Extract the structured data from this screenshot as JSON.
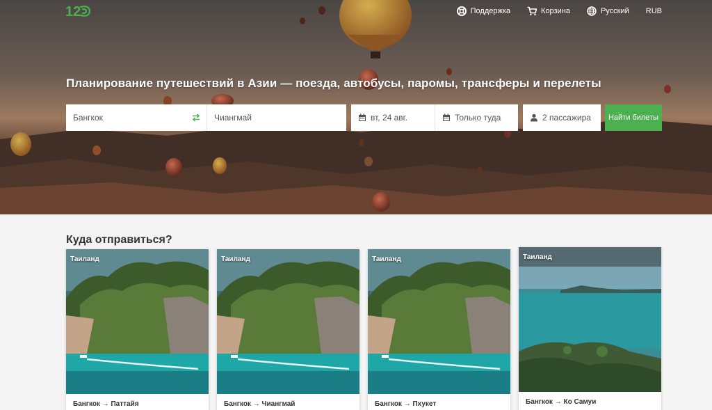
{
  "header": {
    "logo_text": "12go",
    "nav": [
      {
        "label": "Поддержка",
        "icon": "lifebuoy-icon"
      },
      {
        "label": "Корзина",
        "icon": "cart-icon"
      },
      {
        "label": "Русский",
        "icon": "globe-icon"
      },
      {
        "label": "RUB",
        "icon": ""
      }
    ]
  },
  "hero": {
    "headline": "Планирование путешествий в Азии — поезда, автобусы, паромы, трансферы и перелеты"
  },
  "search": {
    "from": "Бангкок",
    "to": "Чиангмай",
    "date": "вт, 24 авг.",
    "trip_type": "Только туда",
    "passengers": "2 пассажира",
    "submit_label": "Найти билеты"
  },
  "destinations": {
    "title": "Куда отправиться?",
    "cards": [
      {
        "tag": "Таиланд",
        "route": "Бангкок → Паттайя"
      },
      {
        "tag": "Таиланд",
        "route": "Бангкок → Чиангмай"
      },
      {
        "tag": "Таиланд",
        "route": "Бангкок → Пхукет"
      },
      {
        "tag": "Таиланд",
        "route": "Бангкок → Ко Самуи"
      }
    ]
  },
  "colors": {
    "accent": "#4caf50",
    "logo": "#4caf50"
  }
}
